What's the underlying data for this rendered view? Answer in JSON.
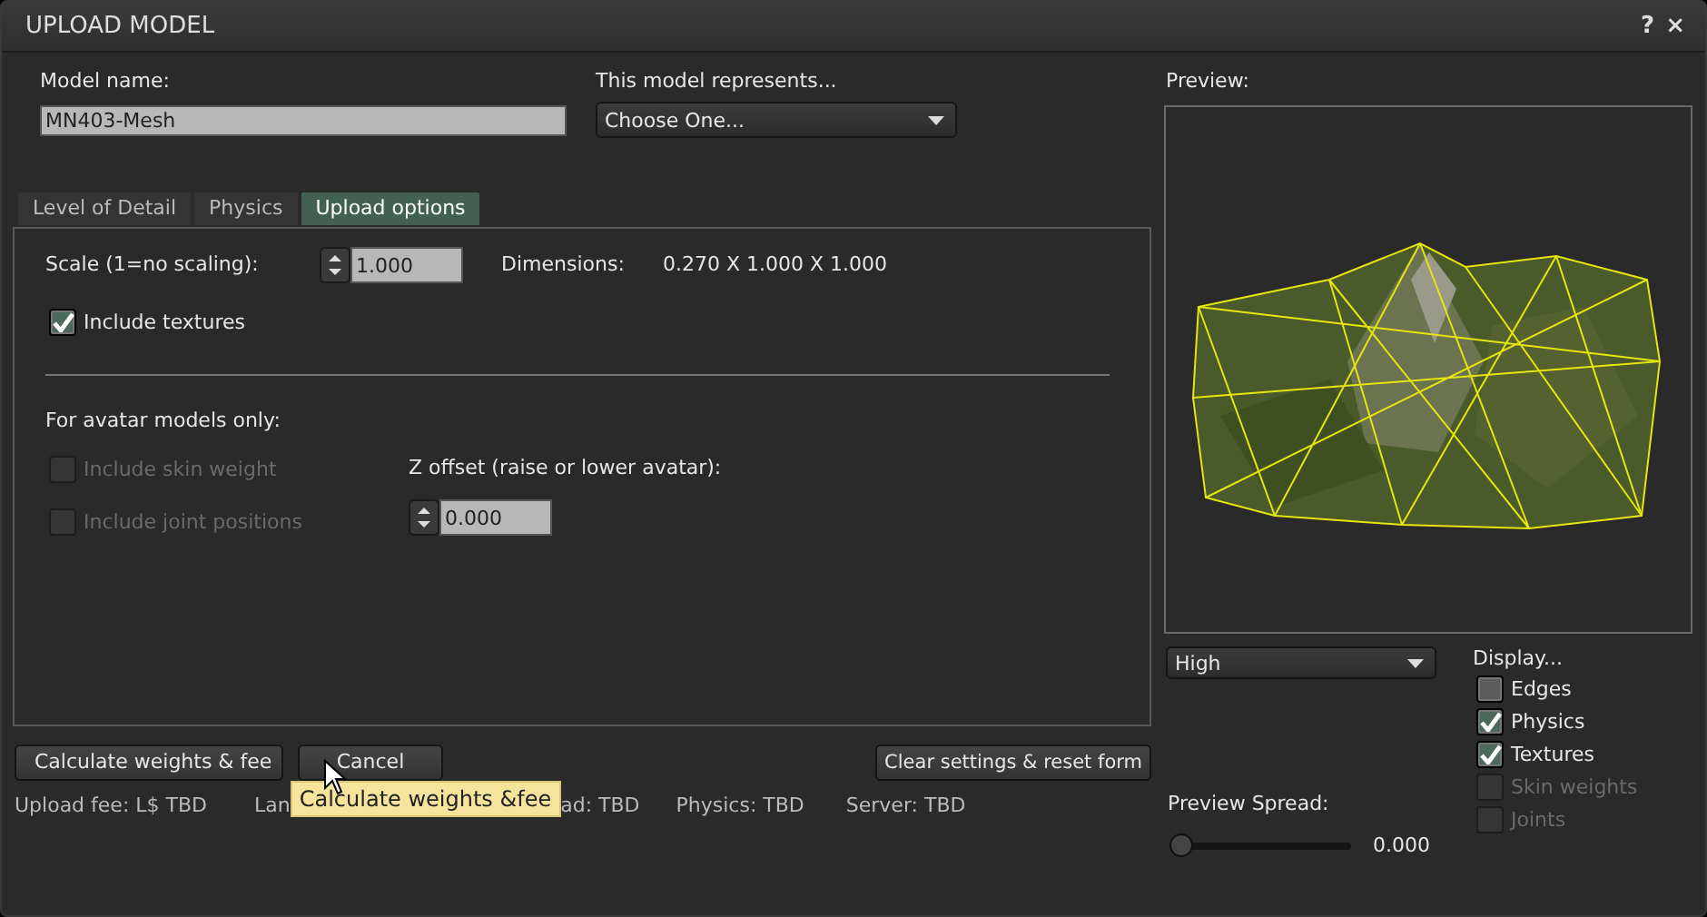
{
  "window": {
    "title": "UPLOAD MODEL",
    "help": "?",
    "close": "×"
  },
  "model_name": {
    "label": "Model name:",
    "value": "MN403-Mesh"
  },
  "represents": {
    "label": "This model represents...",
    "value": "Choose One..."
  },
  "tabs": [
    {
      "label": "Level of Detail",
      "selected": false
    },
    {
      "label": "Physics",
      "selected": false
    },
    {
      "label": "Upload options",
      "selected": true
    }
  ],
  "upload_options": {
    "scale": {
      "label": "Scale (1=no scaling):",
      "value": "1.000"
    },
    "dimensions": {
      "label": "Dimensions:",
      "value": "0.270 X 1.000 X 1.000"
    },
    "include_textures": {
      "label": "Include textures",
      "checked": true,
      "disabled": false
    },
    "avatar_heading": "For avatar models only:",
    "avatar_options": [
      {
        "label": "Include skin weight",
        "checked": false,
        "disabled": true
      },
      {
        "label": "Include joint positions",
        "checked": false,
        "disabled": true
      }
    ],
    "z_offset": {
      "label": "Z offset (raise or lower avatar):",
      "value": "0.000"
    }
  },
  "buttons": [
    {
      "label": "Calculate weights & fee"
    },
    {
      "label": "Cancel"
    },
    {
      "label": "Clear settings & reset form"
    }
  ],
  "status": [
    "Upload fee: L$ TBD",
    "Lan",
    "ad: TBD",
    "Physics: TBD",
    "Server: TBD"
  ],
  "tooltip": "Calculate weights &fee",
  "preview": {
    "label": "Preview:",
    "lod": "High",
    "display_label": "Display...",
    "display": [
      {
        "label": "Edges",
        "checked": false,
        "disabled": false
      },
      {
        "label": "Physics",
        "checked": true,
        "disabled": false
      },
      {
        "label": "Textures",
        "checked": true,
        "disabled": false
      },
      {
        "label": "Skin weights",
        "checked": false,
        "disabled": true
      },
      {
        "label": "Joints",
        "checked": false,
        "disabled": true
      }
    ],
    "spread": {
      "label": "Preview Spread:",
      "level": 0,
      "reading": "0.000"
    }
  }
}
